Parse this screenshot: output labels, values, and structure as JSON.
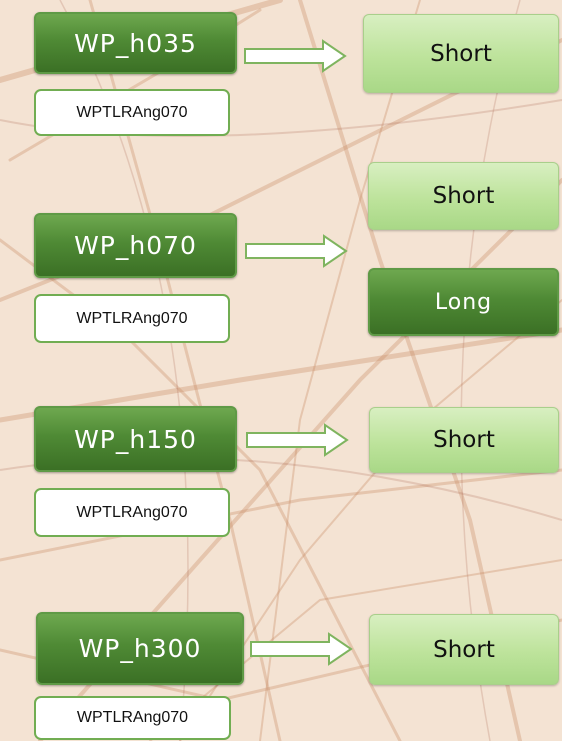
{
  "rows": [
    {
      "label": "WP_h035",
      "sub": "WPTLRAng070",
      "outputs": [
        "Short"
      ]
    },
    {
      "label": "WP_h070",
      "sub": "WPTLRAng070",
      "outputs": [
        "Short",
        "Long"
      ]
    },
    {
      "label": "WP_h150",
      "sub": "WPTLRAng070",
      "outputs": [
        "Short"
      ]
    },
    {
      "label": "WP_h300",
      "sub": "WPTLRAng070",
      "outputs": [
        "Short"
      ]
    }
  ],
  "colors": {
    "dark_green": "#4f8a35",
    "light_green": "#bde39b",
    "note_border": "#71ad52",
    "arrow_fill": "#ffffff",
    "arrow_stroke": "#7fb45f",
    "background": "#f4e3d3"
  }
}
